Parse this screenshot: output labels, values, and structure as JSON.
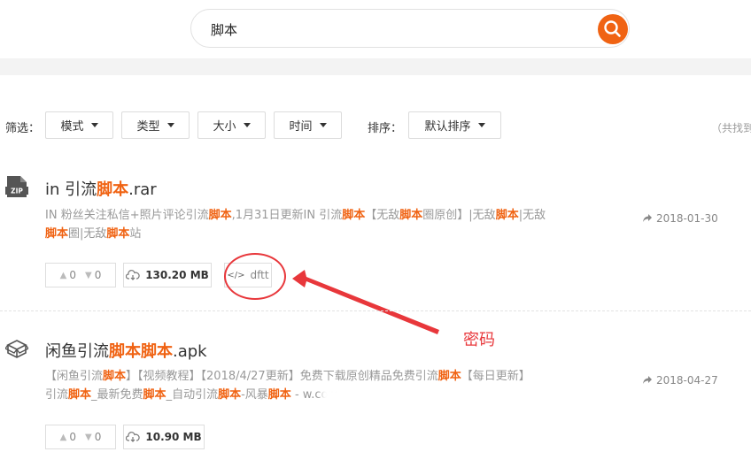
{
  "search": {
    "query": "脚本"
  },
  "filters": {
    "label": "筛选：",
    "buttons": [
      "模式",
      "类型",
      "大小",
      "时间"
    ],
    "sort_label": "排序：",
    "sort_value": "默认排序",
    "found_text": "（共找到"
  },
  "results": [
    {
      "icon": "zip-file-icon",
      "title_prefix": "in 引流",
      "title_hl": "脚本",
      "title_suffix": ".rar",
      "desc_line1": [
        {
          "t": "IN 粉丝关注私信+照片评论引流",
          "h": false
        },
        {
          "t": "脚本",
          "h": true
        },
        {
          "t": ",1月31日更新IN 引流",
          "h": false
        },
        {
          "t": "脚本",
          "h": true
        },
        {
          "t": "【无敌",
          "h": false
        },
        {
          "t": "脚本",
          "h": true
        },
        {
          "t": "圈原创】|无敌",
          "h": false
        },
        {
          "t": "脚本",
          "h": true
        },
        {
          "t": "|无敌",
          "h": false
        }
      ],
      "desc_line2": [
        {
          "t": "脚本",
          "h": true
        },
        {
          "t": "圈|无敌",
          "h": false
        },
        {
          "t": "脚本",
          "h": true
        },
        {
          "t": "站",
          "h": false
        }
      ],
      "date": "2018-01-30",
      "up": "0",
      "down": "0",
      "size": "130.20 MB",
      "code": "dftt"
    },
    {
      "icon": "box-package-icon",
      "title_prefix": "闲鱼引流",
      "title_hl": "脚本脚本",
      "title_suffix": ".apk",
      "desc_line1": [
        {
          "t": "【闲鱼引流",
          "h": false
        },
        {
          "t": "脚本",
          "h": true
        },
        {
          "t": "】【视频教程】【2018/4/27更新】免费下载原创精品免费引流",
          "h": false
        },
        {
          "t": "脚本",
          "h": true
        },
        {
          "t": "【每日更新】",
          "h": false
        }
      ],
      "desc_line2": [
        {
          "t": "引流",
          "h": false
        },
        {
          "t": "脚本",
          "h": true
        },
        {
          "t": "_最新免费",
          "h": false
        },
        {
          "t": "脚本",
          "h": true
        },
        {
          "t": "_自动引流",
          "h": false
        },
        {
          "t": "脚本",
          "h": true
        },
        {
          "t": "-风暴",
          "h": false
        },
        {
          "t": "脚本",
          "h": true
        },
        {
          "t": " - w",
          "h": false
        },
        {
          "t": ".com",
          "h": false
        }
      ],
      "date": "2018-04-27",
      "up": "0",
      "down": "0",
      "size": "10.90 MB"
    }
  ],
  "annotation": {
    "text": "密码"
  },
  "colors": {
    "accent": "#f06313",
    "annotation": "#e8373b"
  }
}
